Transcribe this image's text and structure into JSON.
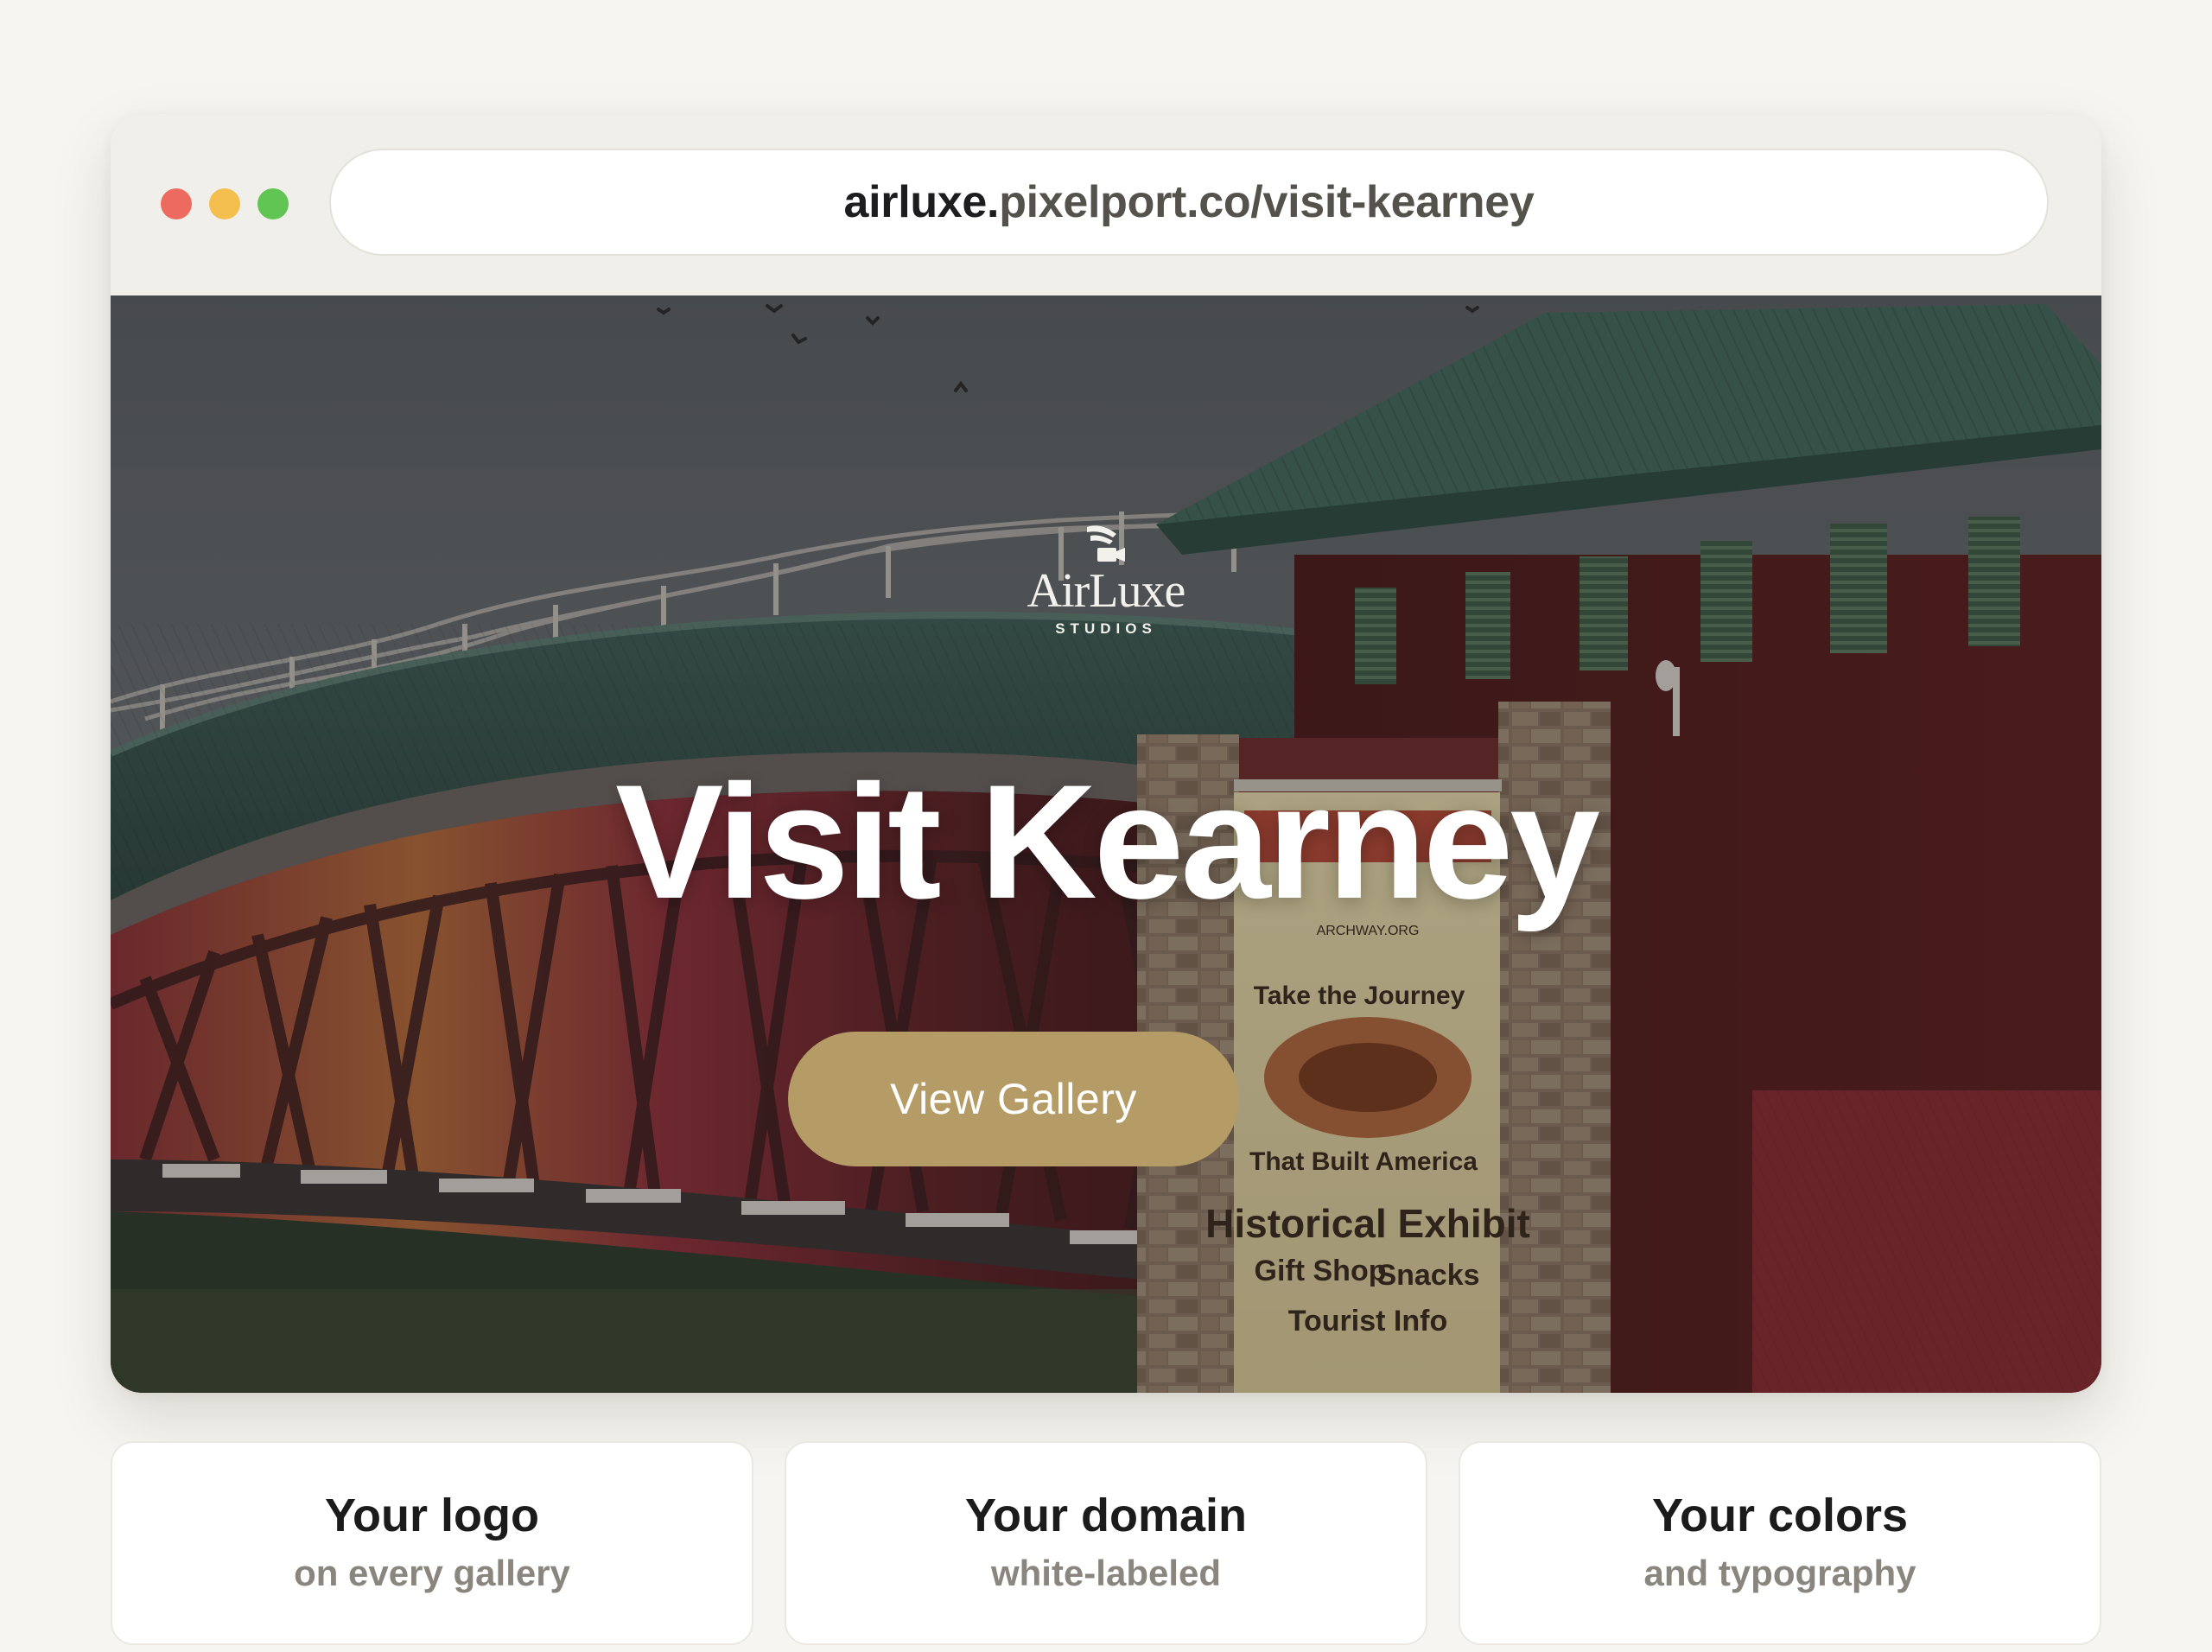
{
  "browser": {
    "url_subdomain": "airluxe.",
    "url_rest": "pixelport.co/visit-kearney"
  },
  "hero": {
    "logo_name": "AirLuxe",
    "logo_tagline": "STUDIOS",
    "title": "Visit Kearney",
    "cta_label": "View Gallery",
    "cta_color": "#b59c67",
    "sign": {
      "site": "ARCHWAY.ORG",
      "line1": "Take the Journey",
      "line2": "That Built America",
      "line3": "Historical Exhibit",
      "line4a": "Gift Shop",
      "line4b": "Snacks",
      "line5": "Tourist Info"
    }
  },
  "features": [
    {
      "title": "Your logo",
      "subtitle": "on every gallery"
    },
    {
      "title": "Your domain",
      "subtitle": "white-labeled"
    },
    {
      "title": "Your colors",
      "subtitle": "and typography"
    }
  ]
}
